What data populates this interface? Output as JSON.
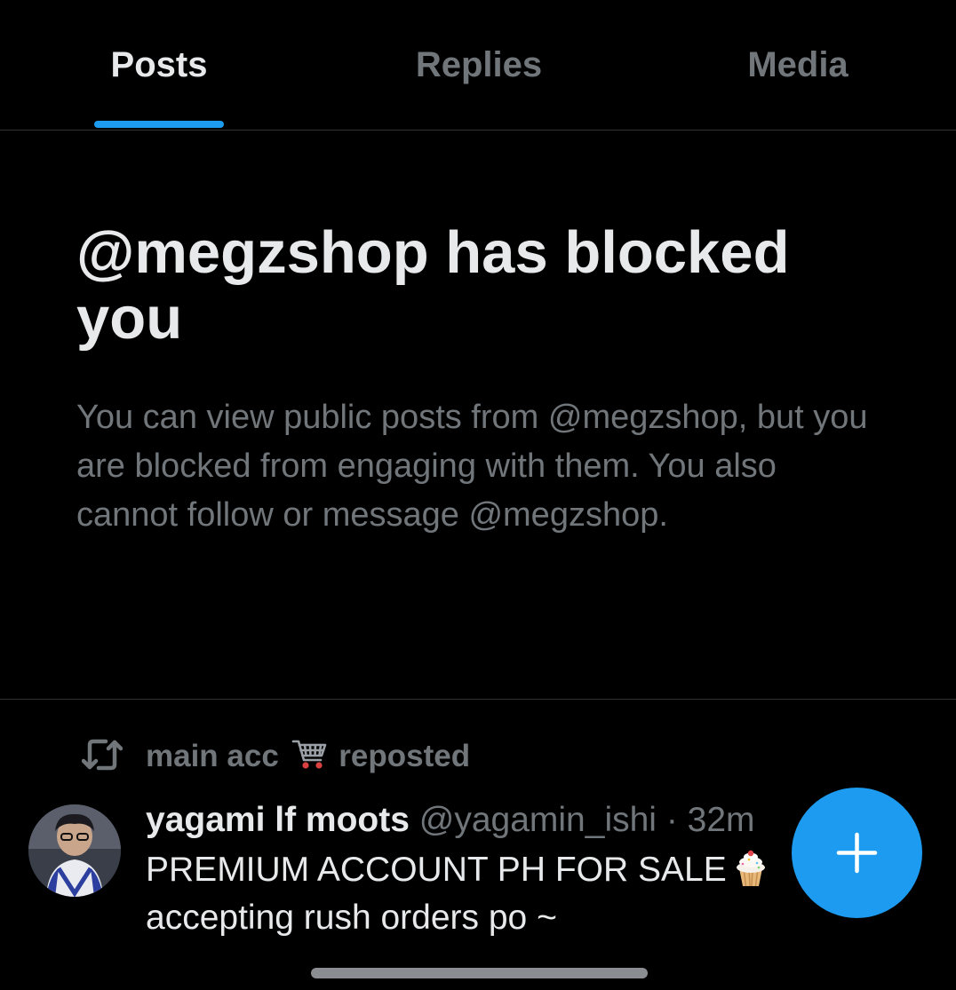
{
  "tabs": [
    {
      "label": "Posts",
      "active": true
    },
    {
      "label": "Replies",
      "active": false
    },
    {
      "label": "Media",
      "active": false
    }
  ],
  "block_notice": {
    "title": "@megzshop has blocked you",
    "description": "You can view public posts from @megzshop, but you are blocked from engaging with them. You also cannot follow or message @megzshop."
  },
  "repost": {
    "icon": "repost-icon",
    "account": "main acc",
    "emoji_icon": "shopping-cart-icon",
    "label": "reposted"
  },
  "post": {
    "author_name": "yagami lf moots",
    "author_handle": "@yagamin_ishi",
    "separator": "·",
    "time": "32m",
    "text_line1": "PREMIUM ACCOUNT PH FOR SALE",
    "text_emoji_icon": "cupcake-icon",
    "text_line2": "accepting rush orders po ~"
  },
  "fab": {
    "icon": "plus-icon"
  },
  "colors": {
    "background": "#000000",
    "accent": "#1d9bf0",
    "primary_text": "#e7e9ea",
    "secondary_text": "#71767b",
    "divider": "#2f3336"
  }
}
